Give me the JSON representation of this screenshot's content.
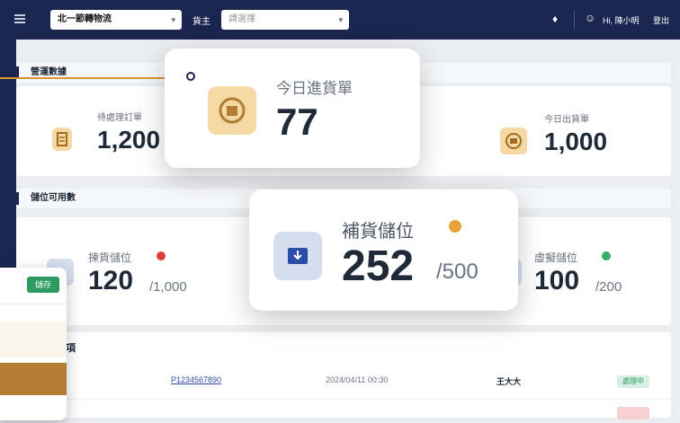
{
  "topbar": {
    "warehouse_select": "北一節轉物流",
    "owner_label": "貨主",
    "owner_placeholder": "請選擇",
    "greeting": "Hi, 陳小明",
    "logout": "登出"
  },
  "icons": {
    "menu": "hamburger-icon",
    "bell": "bell-icon",
    "user": "user-icon",
    "chevron": "chevron-down-icon"
  },
  "stats_section": {
    "title": "營運數據",
    "pending_orders": {
      "label": "待處理訂單",
      "value": "1,200"
    },
    "today_inbound": {
      "label": "今日進貨單",
      "value": "77"
    },
    "today_outbound": {
      "label": "今日出貨單",
      "value": "1,000"
    }
  },
  "location_section": {
    "title": "儲位可用數",
    "picking": {
      "label": "揀貨儲位",
      "value": "120",
      "total": "/1,000",
      "status_color": "#e03e3e"
    },
    "replenish": {
      "label": "補貨儲位",
      "value": "252",
      "total": "/500",
      "status_color": "#e8a33a"
    },
    "virtual": {
      "label": "虛擬儲位",
      "value": "100",
      "total": "/200",
      "status_color": "#38b061"
    }
  },
  "todo_section": {
    "title": "事項",
    "rows": [
      {
        "order": "P1234567890",
        "time": "2024/04/11 00:30",
        "person": "王大大",
        "status": "處理中"
      }
    ]
  },
  "side_panel": {
    "save_label": "儲存"
  },
  "colors": {
    "navy": "#1a2650",
    "accent": "#d6952e",
    "save": "#2d9a62"
  }
}
